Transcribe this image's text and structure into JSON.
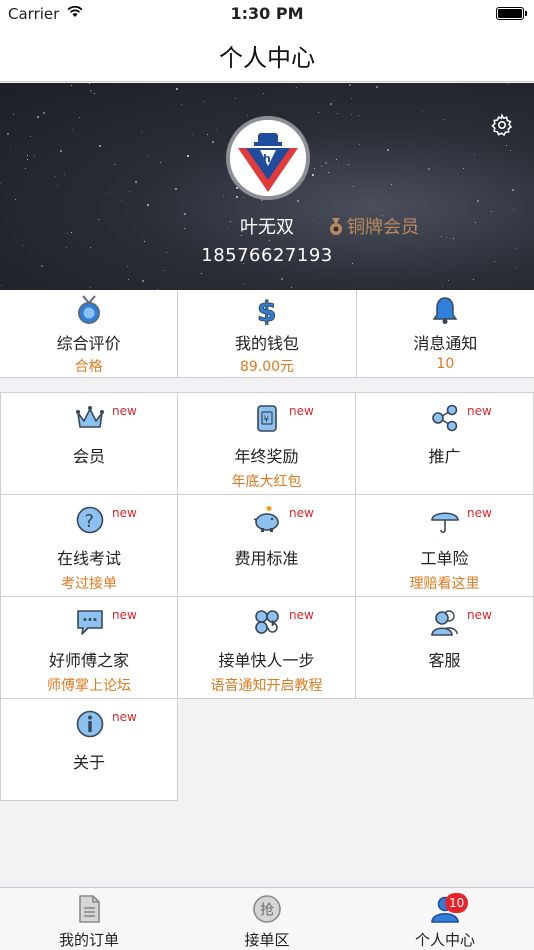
{
  "status_bar": {
    "carrier": "Carrier",
    "time": "1:30 PM"
  },
  "nav": {
    "title": "个人中心"
  },
  "profile": {
    "name": "叶无双",
    "member_level": "铜牌会员",
    "phone": "18576627193"
  },
  "stats": [
    {
      "icon": "medal-icon",
      "label": "综合评价",
      "value": "合格"
    },
    {
      "icon": "wallet-icon",
      "label": "我的钱包",
      "value": "89.00元"
    },
    {
      "icon": "bell-icon",
      "label": "消息通知",
      "value": "10"
    }
  ],
  "menu": [
    {
      "icon": "crown-icon",
      "badge": "new",
      "label": "会员",
      "sub": ""
    },
    {
      "icon": "red-envelope-icon",
      "badge": "new",
      "label": "年终奖励",
      "sub": "年底大红包"
    },
    {
      "icon": "share-icon",
      "badge": "new",
      "label": "推广",
      "sub": ""
    },
    {
      "icon": "question-icon",
      "badge": "new",
      "label": "在线考试",
      "sub": "考过接单"
    },
    {
      "icon": "piggy-bank-icon",
      "badge": "new",
      "label": "费用标准",
      "sub": ""
    },
    {
      "icon": "umbrella-icon",
      "badge": "new",
      "label": "工单险",
      "sub": "理赔看这里"
    },
    {
      "icon": "chat-icon",
      "badge": "new",
      "label": "好师傅之家",
      "sub": "师傅掌上论坛"
    },
    {
      "icon": "clover-icon",
      "badge": "new",
      "label": "接单快人一步",
      "sub": "语音通知开启教程"
    },
    {
      "icon": "customer-service-icon",
      "badge": "new",
      "label": "客服",
      "sub": ""
    },
    {
      "icon": "info-icon",
      "badge": "new",
      "label": "关于",
      "sub": ""
    }
  ],
  "tabs": [
    {
      "icon": "document-icon",
      "label": "我的订单",
      "badge": ""
    },
    {
      "icon": "grab-icon",
      "label": "接单区",
      "badge": "",
      "glyph": "抢"
    },
    {
      "icon": "person-icon",
      "label": "个人中心",
      "badge": "10"
    }
  ],
  "colors": {
    "accent": "#e07a1f",
    "new_badge": "#d9262b",
    "icon_blue": "#2f80d8",
    "member": "#b98a60"
  }
}
